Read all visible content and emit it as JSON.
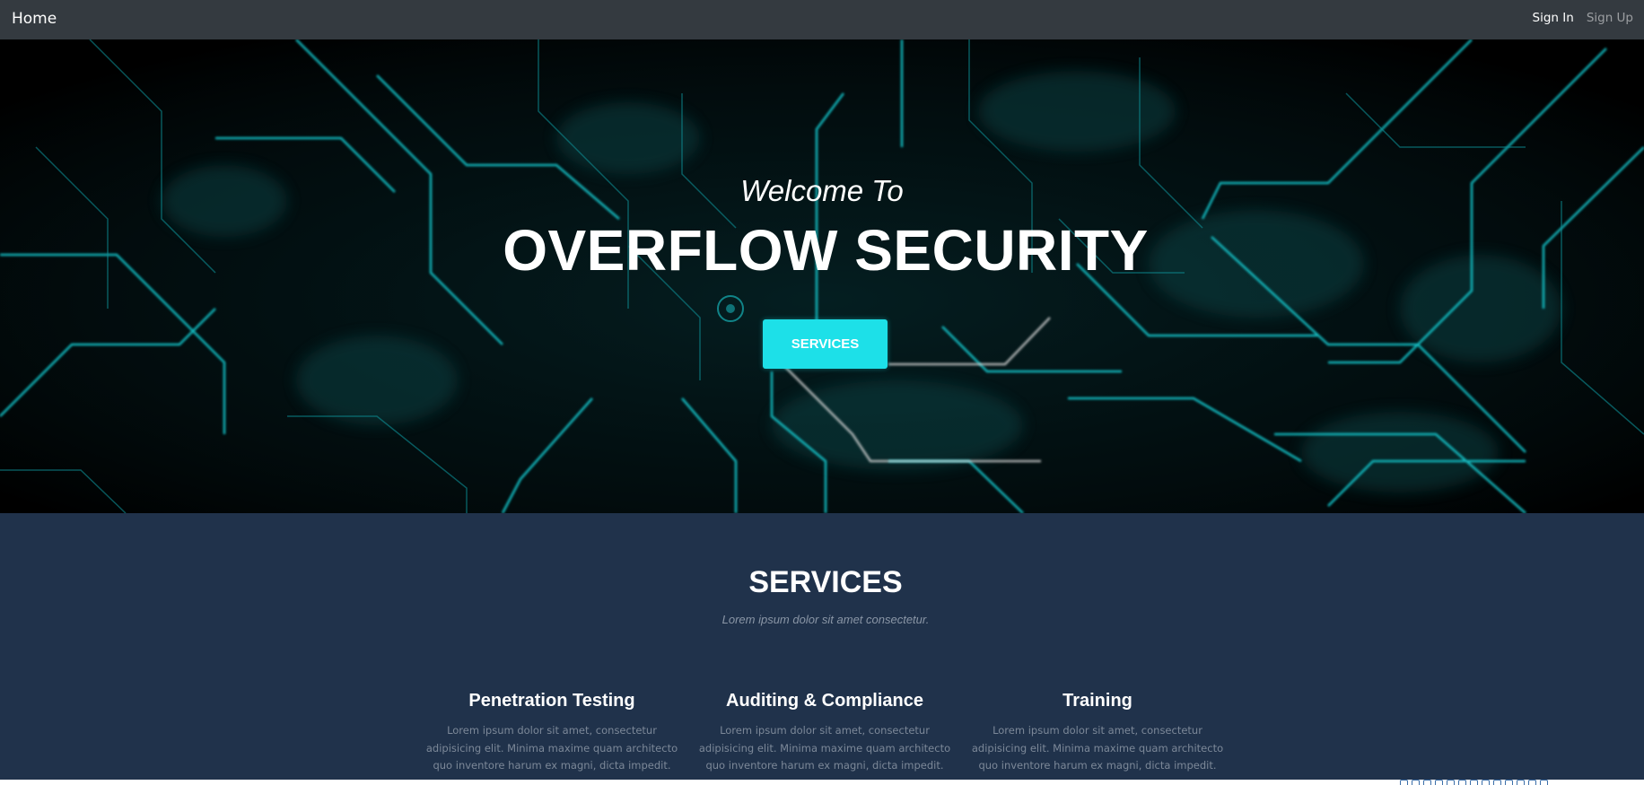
{
  "navbar": {
    "brand": "Home",
    "sign_in": "Sign In",
    "sign_up": "Sign Up"
  },
  "hero": {
    "subtitle": "Welcome To",
    "title": "OVERFLOW SECURITY",
    "button_label": "SERVICES",
    "accent_color": "#1de0e8"
  },
  "services": {
    "heading": "SERVICES",
    "subheading": "Lorem ipsum dolor sit amet consectetur.",
    "items": [
      {
        "title": "Penetration Testing",
        "text": "Lorem ipsum dolor sit amet, consectetur adipisicing elit. Minima maxime quam architecto quo inventore harum ex magni, dicta impedit."
      },
      {
        "title": "Auditing & Compliance",
        "text": "Lorem ipsum dolor sit amet, consectetur adipisicing elit. Minima maxime quam architecto quo inventore harum ex magni, dicta impedit."
      },
      {
        "title": "Training",
        "text": "Lorem ipsum dolor sit amet, consectetur adipisicing elit. Minima maxime quam architecto quo inventore harum ex magni, dicta impedit."
      }
    ]
  },
  "colors": {
    "navbar_bg": "#343a40",
    "services_bg": "#20324b",
    "circuit": "#19c9cf"
  }
}
